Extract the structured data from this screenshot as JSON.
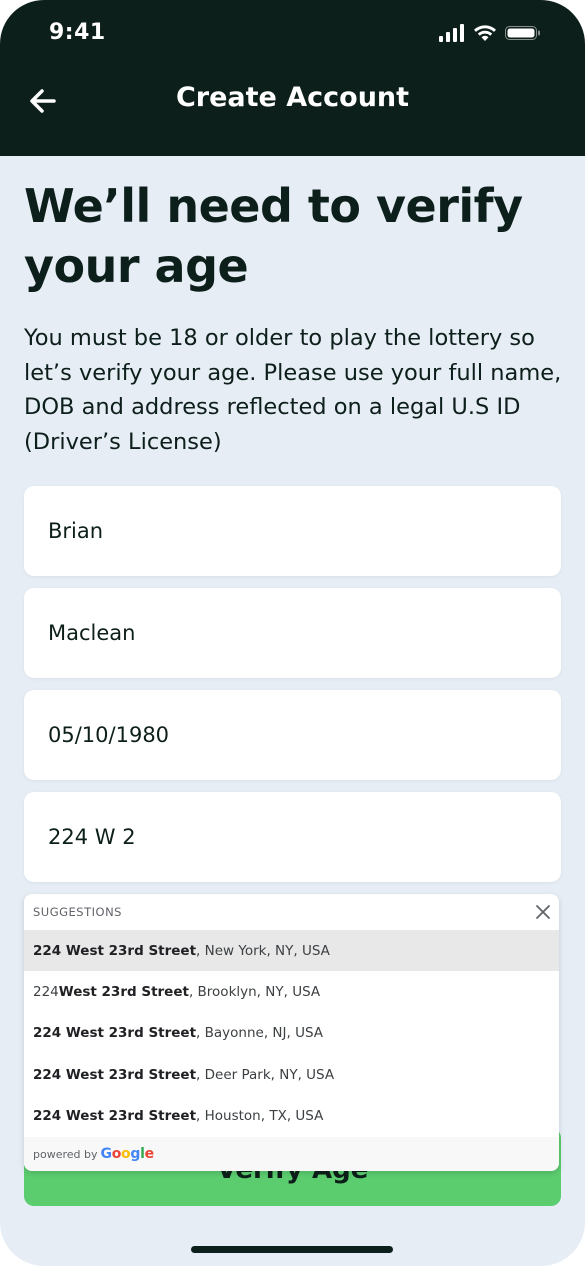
{
  "status_bar": {
    "time": "9:41"
  },
  "header": {
    "title": "Create Account",
    "back_icon": "arrow-left-icon"
  },
  "headline": "We’ll need to verify your age",
  "description": "You must be 18 or older to play the lottery so let’s verify your age. Please use your full name, DOB and address reflected on a legal U.S ID (Driver’s License)",
  "form": {
    "first_name": "Brian",
    "last_name": "Maclean",
    "dob": "05/10/1980",
    "address": "224 W 2"
  },
  "suggestions": {
    "heading": "SUGGESTIONS",
    "items": [
      {
        "bold_prefix": "224 West 23rd Street",
        "plain_prefix": "",
        "rest": ", New York, NY, USA"
      },
      {
        "bold_prefix": "West 23rd Street",
        "plain_prefix": "224 ",
        "rest": ", Brooklyn, NY, USA"
      },
      {
        "bold_prefix": "224 West 23rd Street",
        "plain_prefix": "",
        "rest": ", Bayonne, NJ, USA"
      },
      {
        "bold_prefix": "224 West 23rd Street",
        "plain_prefix": "",
        "rest": ", Deer Park, NY, USA"
      },
      {
        "bold_prefix": "224 West 23rd Street",
        "plain_prefix": "",
        "rest": ", Houston, TX, USA"
      }
    ],
    "powered_by": "powered by",
    "provider": "Google"
  },
  "cta_label": "Verify Age",
  "colors": {
    "header_bg": "#0d1f1a",
    "page_bg": "#e6edf5",
    "cta_bg": "#5ccd6f"
  }
}
